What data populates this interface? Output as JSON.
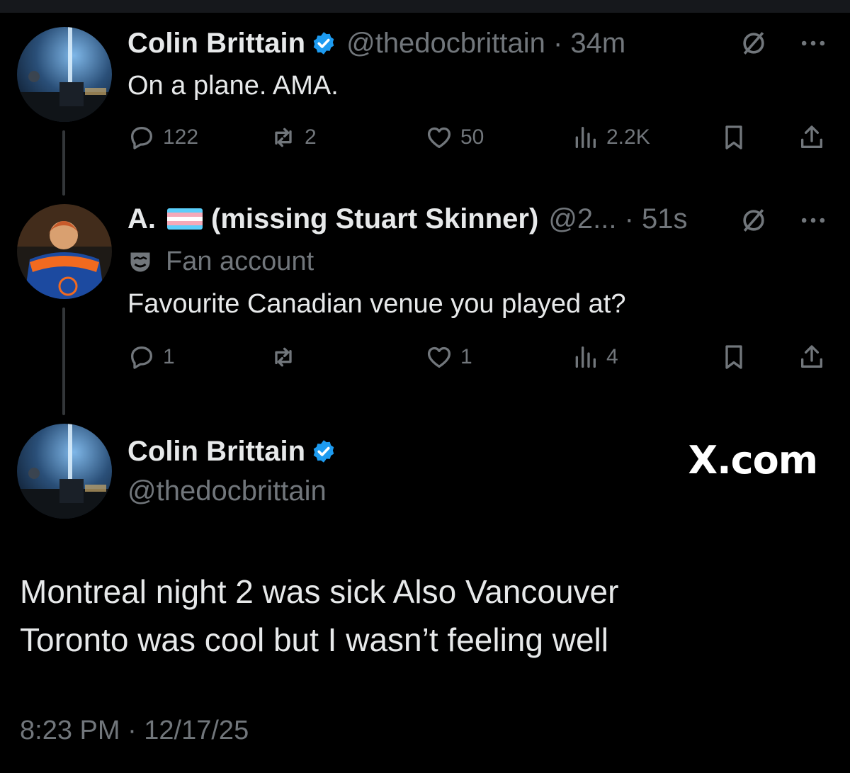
{
  "tweet1": {
    "name": "Colin Brittain",
    "handle_time": "@thedocbrittain · 34m",
    "text": "On a plane.  AMA.",
    "stats": {
      "replies": "122",
      "reposts": "2",
      "likes": "50",
      "views": "2.2K"
    },
    "icons": [
      "grok-icon",
      "more-icon"
    ]
  },
  "tweet2": {
    "name_prefix": "A.",
    "name_suffix": "(missing Stuart Skinner)",
    "handle_time": "@2... · 51s",
    "label": "Fan account",
    "text": "Favourite Canadian venue you played at?",
    "stats": {
      "replies": "1",
      "reposts": "",
      "likes": "1",
      "views": "4"
    },
    "flag_colors": [
      "#5bcefa",
      "#f5a9b8",
      "#ffffff",
      "#f5a9b8",
      "#5bcefa"
    ]
  },
  "main": {
    "name": "Colin Brittain",
    "handle": "@thedocbrittain",
    "logo": "X.com",
    "text_line1": "Montreal night 2 was sick     Also Vancouver",
    "text_line2": "Toronto was cool but I wasn’t feeling well",
    "timestamp": "8:23 PM · 12/17/25"
  },
  "colors": {
    "verified": "#1d9bf0",
    "muted": "#71767b",
    "text": "#e7e9ea",
    "bg": "#000000"
  }
}
